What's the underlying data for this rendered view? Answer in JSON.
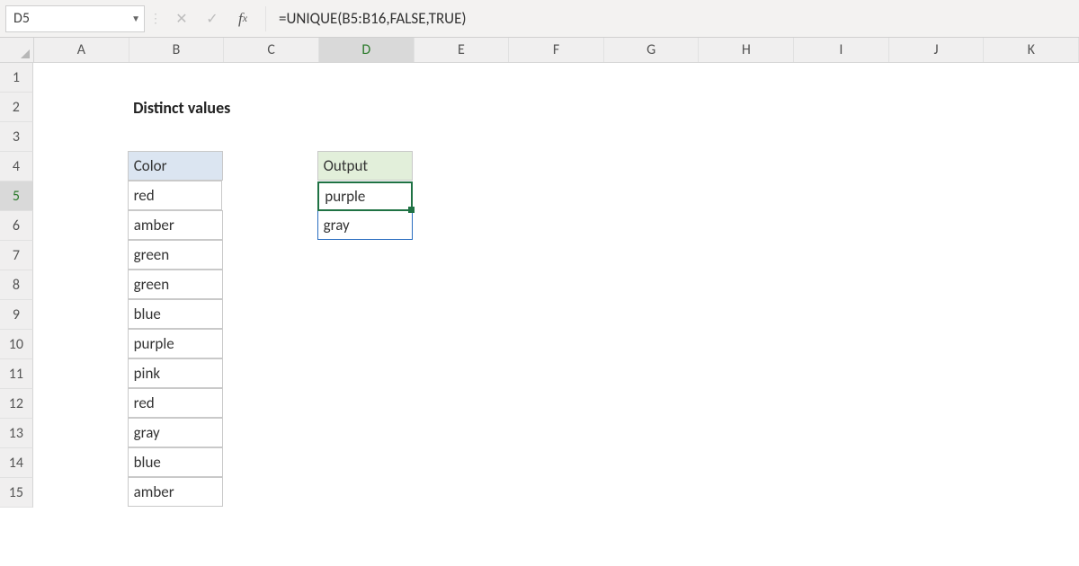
{
  "namebox": {
    "value": "D5"
  },
  "formula_bar": {
    "formula": "=UNIQUE(B5:B16,FALSE,TRUE)"
  },
  "columns": [
    "A",
    "B",
    "C",
    "D",
    "E",
    "F",
    "G",
    "H",
    "I",
    "J",
    "K"
  ],
  "active_column": "D",
  "rows": [
    1,
    2,
    3,
    4,
    5,
    6,
    7,
    8,
    9,
    10,
    11,
    12,
    13,
    14,
    15
  ],
  "active_row": 5,
  "title_cell": {
    "row": 2,
    "col": "B",
    "text": "Distinct values"
  },
  "header_b": {
    "row": 4,
    "text": "Color"
  },
  "header_d": {
    "row": 4,
    "text": "Output"
  },
  "data_b": [
    "red",
    "amber",
    "green",
    "green",
    "blue",
    "purple",
    "pink",
    "red",
    "gray",
    "blue",
    "amber"
  ],
  "output_d": [
    "purple",
    "gray"
  ],
  "selection": {
    "cell": "D5"
  }
}
